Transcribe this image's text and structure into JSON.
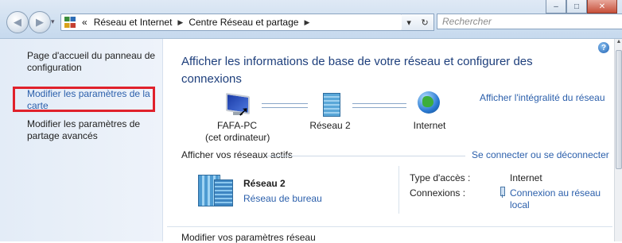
{
  "window": {
    "controls": {
      "minimize": "–",
      "maximize": "□",
      "close": "✕"
    }
  },
  "nav": {
    "back_icon": "back-arrow-icon",
    "forward_icon": "forward-arrow-icon",
    "dropdown": "▾"
  },
  "address": {
    "overflow": "«",
    "crumbs": [
      "Réseau et Internet",
      "Centre Réseau et partage"
    ],
    "separator": "▶",
    "dropdown": "▾",
    "refresh": "↻"
  },
  "search": {
    "placeholder": "Rechercher"
  },
  "leftpane": {
    "home": "Page d'accueil du panneau de configuration",
    "adapter_settings": "Modifier les paramètres de la carte",
    "advanced_sharing": "Modifier les paramètres de partage avancés",
    "highlight_color": "#e0212b"
  },
  "main": {
    "help": "?",
    "title": "Afficher les informations de base de votre réseau et configurer des connexions",
    "full_map_link": "Afficher l'intégralité du réseau",
    "map": {
      "computer": {
        "name": "FAFA-PC",
        "sub": "(cet ordinateur)"
      },
      "network": {
        "name": "Réseau  2"
      },
      "internet": {
        "name": "Internet"
      }
    },
    "active_networks": {
      "heading": "Afficher vos réseaux actifs",
      "connect_link": "Se connecter ou se déconnecter",
      "network_name": "Réseau  2",
      "network_type": "Réseau de bureau",
      "access_type_label": "Type d'accès :",
      "access_type_value": "Internet",
      "connections_label": "Connexions :",
      "connections_value": "Connexion au réseau local"
    },
    "modify_settings_heading": "Modifier vos paramètres réseau"
  },
  "colors": {
    "link": "#2b5fab",
    "title": "#1e3f7c"
  }
}
